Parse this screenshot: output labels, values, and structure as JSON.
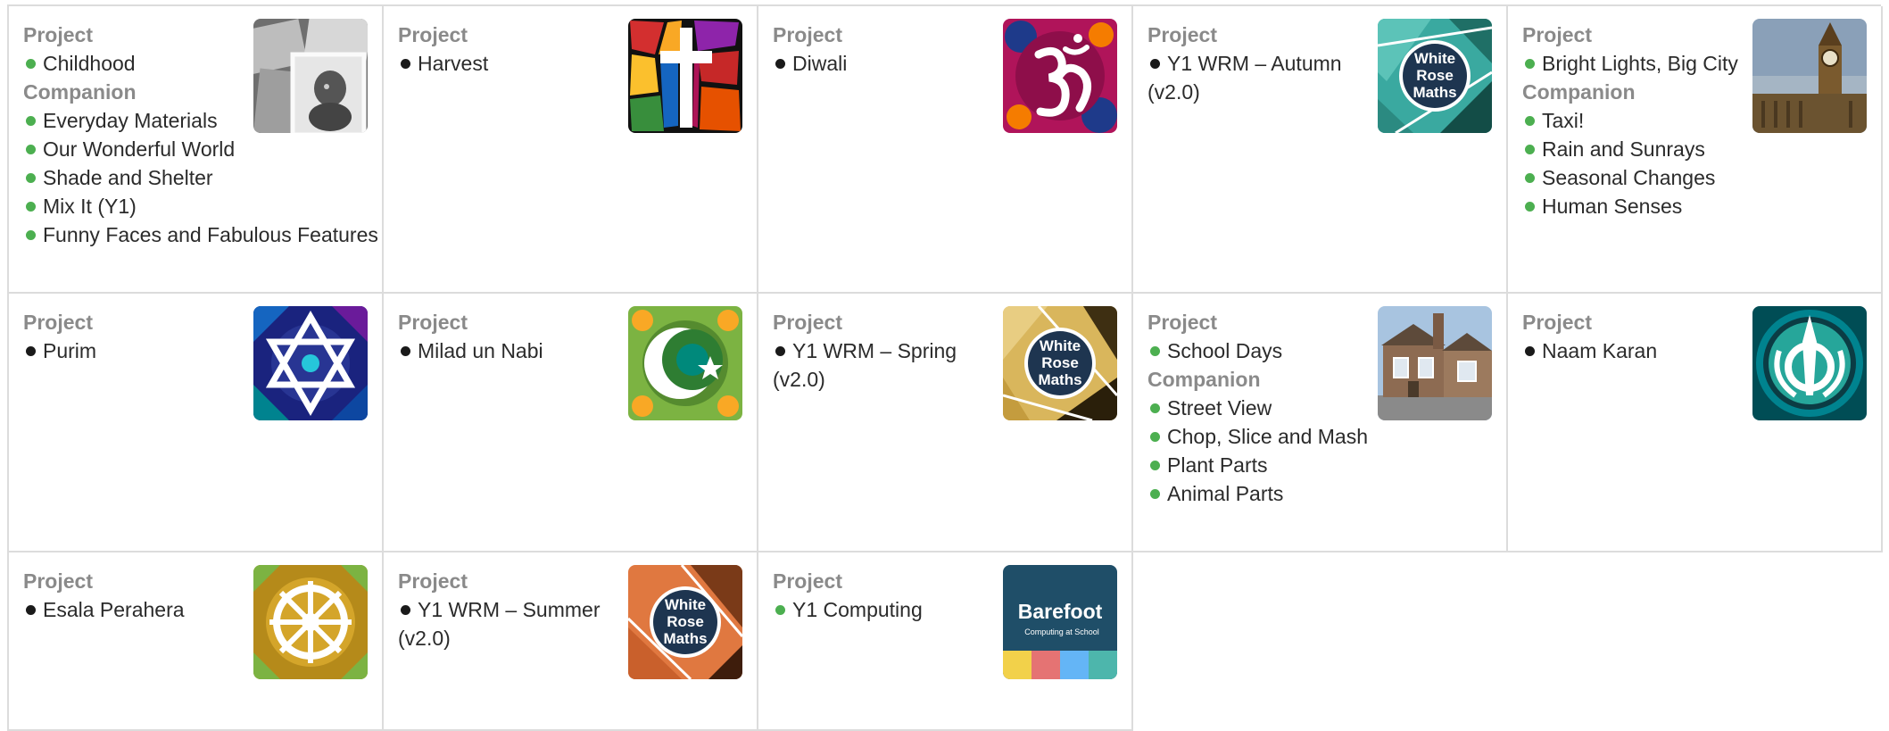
{
  "colors": {
    "green_dot": "#4caf50",
    "black_dot": "#1a1a1a",
    "label_grey": "#8a8a8a",
    "border": "#dcdcdc"
  },
  "cards": [
    {
      "label": "Project",
      "thumb": "old-photos-icon",
      "items": [
        {
          "text": "Childhood",
          "dot": "green"
        }
      ],
      "companion_label": "Companion",
      "companion_items": [
        "Everyday Materials",
        "Our Wonderful World",
        "Shade and Shelter",
        "Mix It (Y1)",
        "Funny Faces and Fabulous Features"
      ]
    },
    {
      "label": "Project",
      "thumb": "cross-stained-glass-icon",
      "items": [
        {
          "text": "Harvest",
          "dot": "black"
        }
      ]
    },
    {
      "label": "Project",
      "thumb": "om-symbol-icon",
      "items": [
        {
          "text": "Diwali",
          "dot": "black"
        }
      ]
    },
    {
      "label": "Project",
      "thumb": "white-rose-maths-teal-icon",
      "items": [
        {
          "text": "Y1 WRM – Autumn (v2.0)",
          "dot": "black"
        }
      ],
      "logo_text": [
        "White",
        "Rose",
        "Maths"
      ]
    },
    {
      "label": "Project",
      "thumb": "big-ben-icon",
      "items": [
        {
          "text": "Bright Lights, Big City",
          "dot": "green"
        }
      ],
      "companion_label": "Companion",
      "companion_items": [
        "Taxi!",
        "Rain and Sunrays",
        "Seasonal Changes",
        "Human Senses"
      ]
    },
    {
      "label": "Project",
      "thumb": "star-of-david-icon",
      "items": [
        {
          "text": "Purim",
          "dot": "black"
        }
      ]
    },
    {
      "label": "Project",
      "thumb": "crescent-star-icon",
      "items": [
        {
          "text": "Milad un Nabi",
          "dot": "black"
        }
      ]
    },
    {
      "label": "Project",
      "thumb": "white-rose-maths-gold-icon",
      "items": [
        {
          "text": "Y1 WRM – Spring (v2.0)",
          "dot": "black"
        }
      ],
      "logo_text": [
        "White",
        "Rose",
        "Maths"
      ]
    },
    {
      "label": "Project",
      "thumb": "school-building-icon",
      "items": [
        {
          "text": "School Days",
          "dot": "green"
        }
      ],
      "companion_label": "Companion",
      "companion_items": [
        "Street View",
        "Chop, Slice and Mash",
        "Plant Parts",
        "Animal Parts"
      ]
    },
    {
      "label": "Project",
      "thumb": "khanda-icon",
      "items": [
        {
          "text": "Naam Karan",
          "dot": "black"
        }
      ]
    },
    {
      "label": "Project",
      "thumb": "dharma-wheel-icon",
      "items": [
        {
          "text": "Esala Perahera",
          "dot": "black"
        }
      ]
    },
    {
      "label": "Project",
      "thumb": "white-rose-maths-orange-icon",
      "items": [
        {
          "text": "Y1 WRM – Summer (v2.0)",
          "dot": "black"
        }
      ],
      "logo_text": [
        "White",
        "Rose",
        "Maths"
      ]
    },
    {
      "label": "Project",
      "thumb": "barefoot-logo-icon",
      "items": [
        {
          "text": "Y1 Computing",
          "dot": "green"
        }
      ],
      "logo_text": [
        "Barefoot",
        "Computing at School"
      ]
    }
  ]
}
